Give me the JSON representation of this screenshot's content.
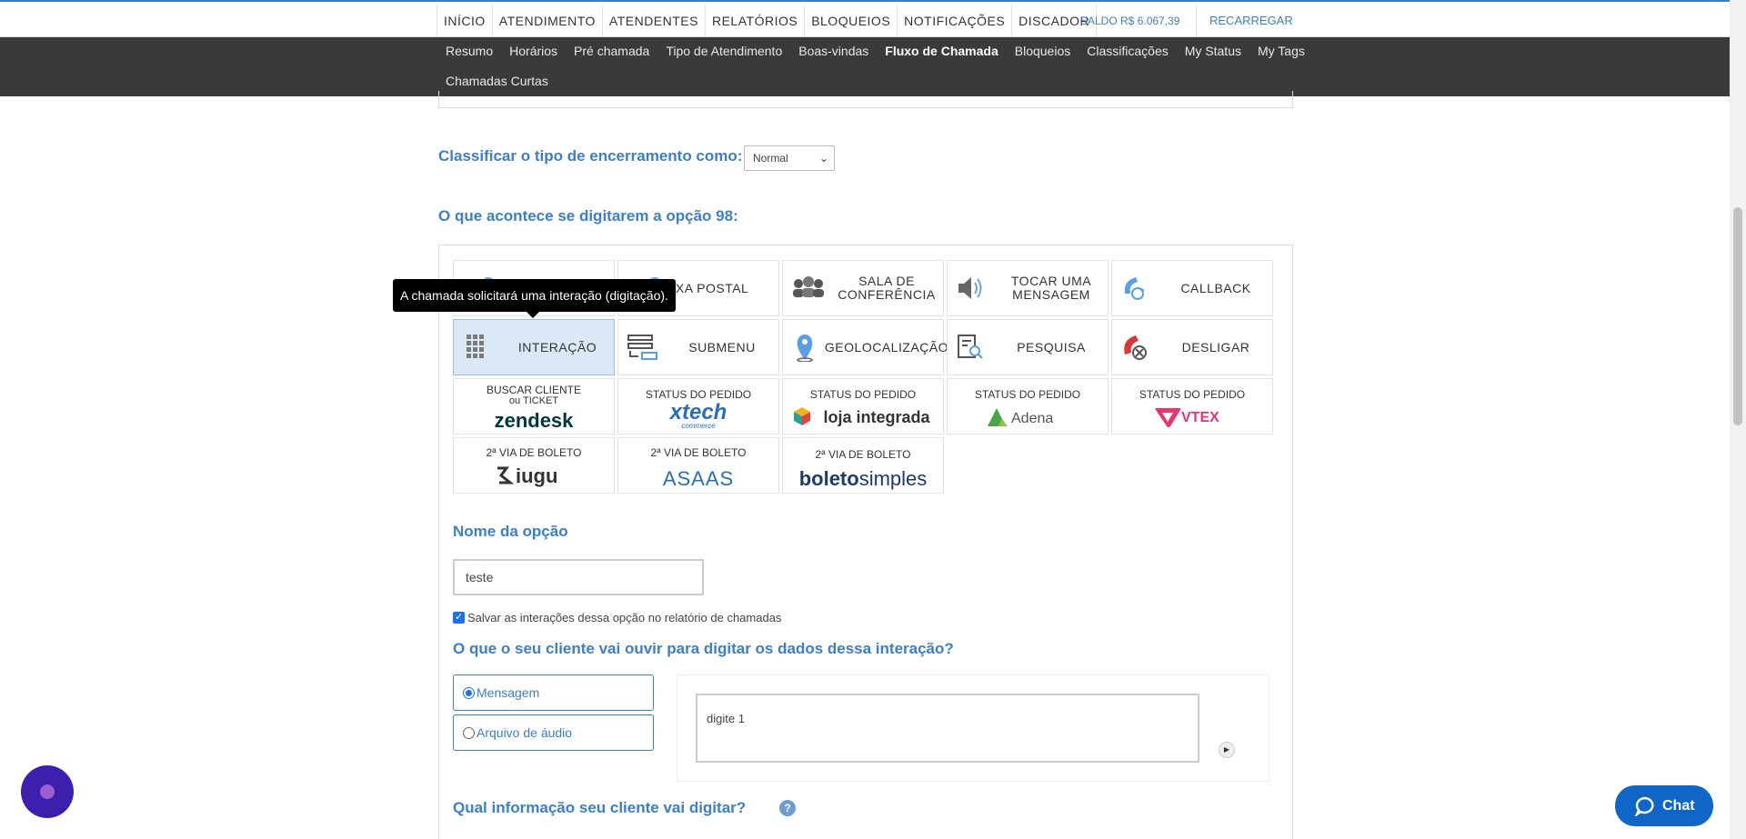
{
  "top_nav": {
    "items": [
      "INÍCIO",
      "ATENDIMENTO",
      "ATENDENTES",
      "RELATÓRIOS",
      "BLOQUEIOS",
      "NOTIFICAÇÕES",
      "DISCADOR"
    ],
    "saldo": "SALDO R$ 6.067,39",
    "recarregar": "RECARREGAR"
  },
  "sub_nav": {
    "items": [
      "Resumo",
      "Horários",
      "Pré chamada",
      "Tipo de Atendimento",
      "Boas-vindas",
      "Fluxo de Chamada",
      "Bloqueios",
      "Classificações",
      "My Status",
      "My Tags",
      "Chamadas Curtas"
    ],
    "active": "Fluxo de Chamada"
  },
  "classify": {
    "label": "Classificar o tipo de encerramento como:",
    "value": "Normal"
  },
  "option_heading": "O que acontece se digitarem a opção 98:",
  "tooltip": "A chamada solicitará uma interação (digitação).",
  "tiles": {
    "caixa_postal": "AIXA POSTAL",
    "sala_line1": "SALA DE",
    "sala_line2": "CONFERÊNCIA",
    "tocar_line1": "TOCAR UMA",
    "tocar_line2": "MENSAGEM",
    "callback": "CALLBACK",
    "interacao": "INTERAÇÃO",
    "submenu": "SUBMENU",
    "geo": "GEOLOCALIZAÇÃO",
    "pesquisa": "PESQUISA",
    "desligar": "DESLIGAR",
    "zendesk_line1": "BUSCAR CLIENTE",
    "zendesk_line2": "ou TICKET",
    "zendesk_logo": "zendesk",
    "status_pedido": "STATUS DO PEDIDO",
    "xtech_logo": "xtech",
    "xtech_sub": "commerce",
    "loja_logo": "loja integrada",
    "adena_logo": "Adena",
    "vtex_logo": "VTEX",
    "boleto_label": "2ª VIA DE BOLETO",
    "iugu_logo": "iugu",
    "asaas_logo": "ASAAS",
    "boletosimples_logo_bold": "boleto",
    "boletosimples_logo_light": "simples"
  },
  "nome_opcao": {
    "label": "Nome da opção",
    "value": "teste"
  },
  "save_checkbox": {
    "label": "Salvar as interações dessa opção no relatório de chamadas",
    "checked": true
  },
  "ouvir_heading": "O que o seu cliente vai ouvir para digitar os dados dessa interação?",
  "radio_options": [
    "Mensagem",
    "Arquivo de áudio"
  ],
  "radio_selected": "Mensagem",
  "message_text": "digite 1",
  "digitar_heading": "Qual informação seu cliente vai digitar?",
  "help_label": "?",
  "chat_label": "Chat",
  "colors": {
    "accent": "#3d7fc4",
    "subnav_bg": "#3a3a3a",
    "chat_button": "#1066c7",
    "bubble": "#3d1fae"
  }
}
